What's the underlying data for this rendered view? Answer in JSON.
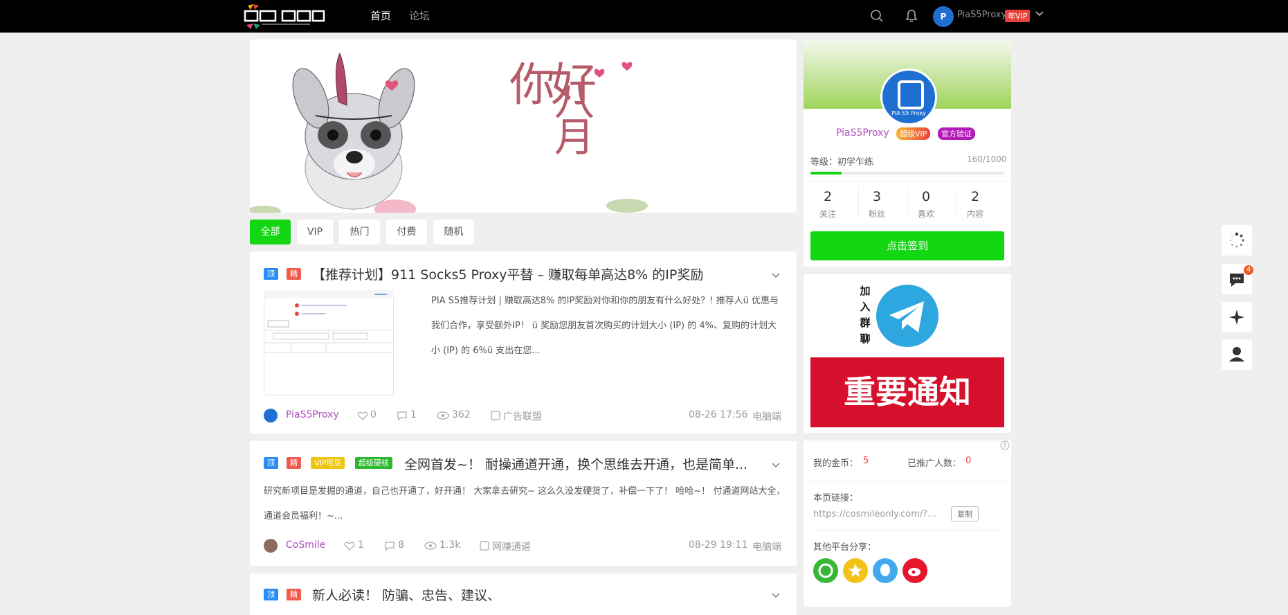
{
  "header": {
    "nav": [
      "首页",
      "论坛"
    ],
    "user": "PiaS5Proxy",
    "vip_badge": "年VIP"
  },
  "banner": {
    "text_1": "你好",
    "text_2": "八月"
  },
  "tabs": [
    "全部",
    "VIP",
    "热门",
    "付费",
    "随机"
  ],
  "posts": [
    {
      "tags": [
        "顶",
        "精"
      ],
      "title": "【推荐计划】911 Socks5 Proxy平替 – 赚取每单高达8% 的IP奖励",
      "excerpt": "PIA S5推荐计划 | 赚取高达8% 的IP奖励对你和你的朋友有什么好处？! 推荐人ü 优惠与我们合作，享受额外IP！ ü 奖励您朋友首次购买的计划大小 (IP) 的 4%、复购的计划大小 (IP) 的 6%ü 支出在您...",
      "author": "PiaS5Proxy",
      "likes": "0",
      "comments": "1",
      "views": "362",
      "category": "广告联盟",
      "date": "08-26 17:56",
      "device": "电脑端"
    },
    {
      "tags": [
        "顶",
        "精",
        "VIP可见",
        "超级硬核"
      ],
      "title": "全网首发~！ 耐操通道开通，换个思维去开通，也是简单...",
      "excerpt": "研究新项目是发掘的通道，自己也开通了，好开通！ 大家拿去研究~ 这么久没发硬货了，补偿一下了！ 哈哈~！ 付通道网站大全，通道会员福利！~...",
      "author": "CoSmile",
      "likes": "1",
      "comments": "8",
      "views": "1.3k",
      "category": "网赚通道",
      "date": "08-29 19:11",
      "device": "电脑端"
    },
    {
      "tags": [
        "顶",
        "精"
      ],
      "title": "新人必读！ 防骗、忠告、建议、"
    }
  ],
  "profile": {
    "name": "PiaS5Proxy",
    "avatar_text": "PIA S5 Proxy",
    "badge_vip": "超级VIP",
    "badge_verified": "官方验证",
    "level_label": "等级：初学乍练",
    "level_value": "160/1000",
    "level_progress": 0.16,
    "stats": [
      {
        "num": "2",
        "label": "关注"
      },
      {
        "num": "3",
        "label": "粉丝"
      },
      {
        "num": "0",
        "label": "喜欢"
      },
      {
        "num": "2",
        "label": "内容"
      }
    ],
    "checkin_button": "点击签到"
  },
  "promo": {
    "join_text": [
      "加",
      "入",
      "群",
      "聊"
    ],
    "notice_text": "重要通知"
  },
  "earnings": {
    "coins_label": "我的金币：",
    "coins_value": "5",
    "promoted_label": "已推广人数：",
    "promoted_value": "0",
    "link_label": "本页链接：",
    "link_value": "https://cosmileonly.com/?...",
    "copy_button": "复制",
    "share_label": "其他平台分享："
  },
  "float": {
    "chat_badge": "4"
  },
  "colors": {
    "accent_green": "#12d712",
    "vip_red": "#e8423a",
    "author_purple": "#b04cbf",
    "tag_blue": "#2a8df5"
  }
}
